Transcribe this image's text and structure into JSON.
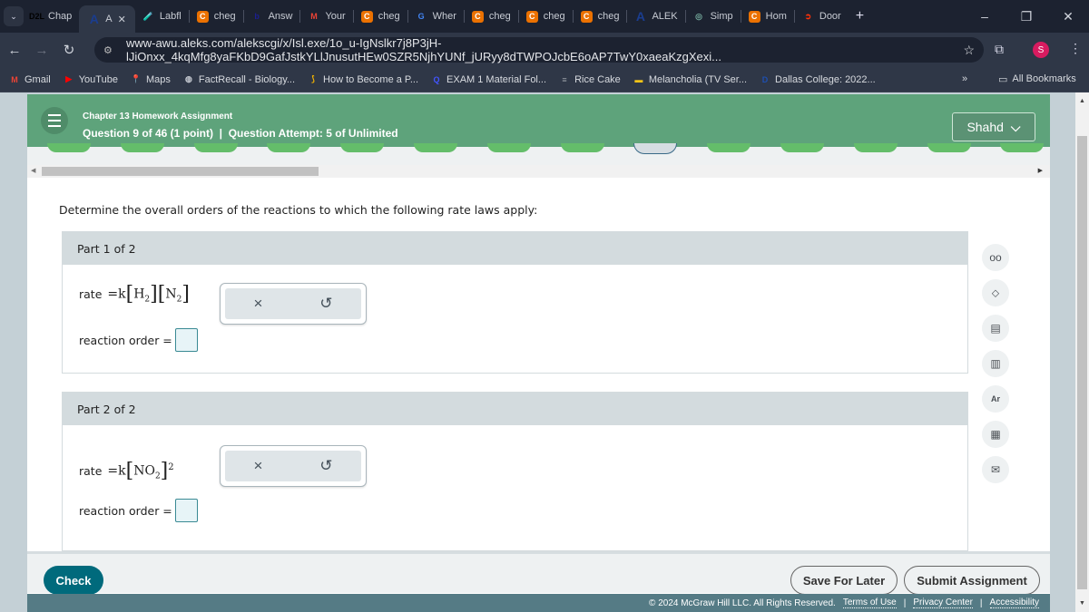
{
  "browser": {
    "tabs": [
      {
        "label": "Chap",
        "icon": "d2l-icon",
        "icon_text": "D2L",
        "color": "#000000"
      },
      {
        "label": "A",
        "icon": "aleks-icon",
        "icon_text": "A",
        "color": "#1a3d8f",
        "active": true
      },
      {
        "label": "Labfl",
        "icon": "labflow-icon",
        "icon_text": "🧪",
        "color": "#c0392b"
      },
      {
        "label": "cheg",
        "icon": "chegg-icon",
        "icon_text": "C",
        "color": "#eb7100"
      },
      {
        "label": "Answ",
        "icon": "brainly-icon",
        "icon_text": "b",
        "color": "#1b1f8f"
      },
      {
        "label": "Your",
        "icon": "gmail-icon",
        "icon_text": "M",
        "color": "#ea4335"
      },
      {
        "label": "cheg",
        "icon": "chegg-icon",
        "icon_text": "C",
        "color": "#eb7100"
      },
      {
        "label": "Wher",
        "icon": "google-icon",
        "icon_text": "G",
        "color": "#4285f4"
      },
      {
        "label": "cheg",
        "icon": "chegg-icon",
        "icon_text": "C",
        "color": "#eb7100"
      },
      {
        "label": "cheg",
        "icon": "chegg-icon",
        "icon_text": "C",
        "color": "#eb7100"
      },
      {
        "label": "cheg",
        "icon": "chegg-icon",
        "icon_text": "C",
        "color": "#eb7100"
      },
      {
        "label": "ALEK",
        "icon": "aleks-icon",
        "icon_text": "A",
        "color": "#1a3d8f"
      },
      {
        "label": "Simp",
        "icon": "chatgpt-icon",
        "icon_text": "◎",
        "color": "#74aa9c"
      },
      {
        "label": "Hom",
        "icon": "chegg-icon",
        "icon_text": "C",
        "color": "#eb7100"
      },
      {
        "label": "Door",
        "icon": "doordash-icon",
        "icon_text": "➲",
        "color": "#ff3008"
      }
    ],
    "new_tab": "+",
    "url": "www-awu.aleks.com/alekscgi/x/Isl.exe/1o_u-IgNslkr7j8P3jH-lJiOnxx_4kqMfg8yaFKbD9GafJstkYLlJnusutHEw0SZR5NjhYUNf_jURyy8dTWPOJcbE6oAP7TwY0xaeaKzgXexi...",
    "profile_initial": "S",
    "bookmarks": [
      {
        "label": "Gmail",
        "icon": "gmail-icon",
        "icon_text": "M",
        "color": "#ea4335"
      },
      {
        "label": "YouTube",
        "icon": "youtube-icon",
        "icon_text": "▶",
        "color": "#ff0000"
      },
      {
        "label": "Maps",
        "icon": "maps-icon",
        "icon_text": "📍",
        "color": "#34a853"
      },
      {
        "label": "FactRecall - Biology...",
        "icon": "globe-icon",
        "icon_text": "◍",
        "color": "#c8ccd4"
      },
      {
        "label": "How to Become a P...",
        "icon": "flag-icon",
        "icon_text": "⟆",
        "color": "#f4b400"
      },
      {
        "label": "EXAM 1 Material Fol...",
        "icon": "quizlet-icon",
        "icon_text": "Q",
        "color": "#4255ff"
      },
      {
        "label": "Rice Cake",
        "icon": "page-icon",
        "icon_text": "≡",
        "color": "#9aa0a6"
      },
      {
        "label": "Melancholia (TV Ser...",
        "icon": "imdb-icon",
        "icon_text": "▬",
        "color": "#f5c518"
      },
      {
        "label": "Dallas College: 2022...",
        "icon": "dallas-college-icon",
        "icon_text": "D",
        "color": "#1e4fb0"
      }
    ],
    "more_bookmarks": "»",
    "all_bookmarks": "All Bookmarks"
  },
  "header": {
    "assignment_title": "Chapter 13 Homework Assignment",
    "question_info": "Question 9 of 46 (1 point)  |  Question Attempt: 5 of Unlimited",
    "user_name": "Shahd"
  },
  "question_nav": {
    "current_index": 9,
    "visible_count": 17
  },
  "question": {
    "prompt": "Determine the overall orders of the reactions to which the following rate laws apply:",
    "parts": [
      {
        "header": "Part 1 of 2",
        "rate_label": "rate",
        "rate_law_k": "=k",
        "species": [
          "H",
          "N"
        ],
        "subscripts": [
          "2",
          "2"
        ],
        "exponent": "",
        "order_label": "reaction order =",
        "answer": ""
      },
      {
        "header": "Part 2 of 2",
        "rate_label": "rate",
        "rate_law_k": "=k",
        "species": [
          "NO"
        ],
        "subscripts": [
          "2"
        ],
        "exponent": "2",
        "order_label": "reaction order =",
        "answer": ""
      }
    ],
    "tool_clear": "×",
    "tool_undo": "↺"
  },
  "side_tools": [
    {
      "name": "glasses-icon",
      "glyph": "oo"
    },
    {
      "name": "directions-icon",
      "glyph": "⬦"
    },
    {
      "name": "notes-icon",
      "glyph": "▤"
    },
    {
      "name": "data-chart-icon",
      "glyph": "▥"
    },
    {
      "name": "periodic-table-icon",
      "glyph": "Ar"
    },
    {
      "name": "calculator-icon",
      "glyph": "▦"
    },
    {
      "name": "mail-icon",
      "glyph": "✉"
    }
  ],
  "footer": {
    "check": "Check",
    "save_for_later": "Save For Later",
    "submit": "Submit Assignment",
    "copyright": "© 2024 McGraw Hill LLC. All Rights Reserved.",
    "terms": "Terms of Use",
    "privacy": "Privacy Center",
    "accessibility": "Accessibility",
    "separator": "|"
  }
}
